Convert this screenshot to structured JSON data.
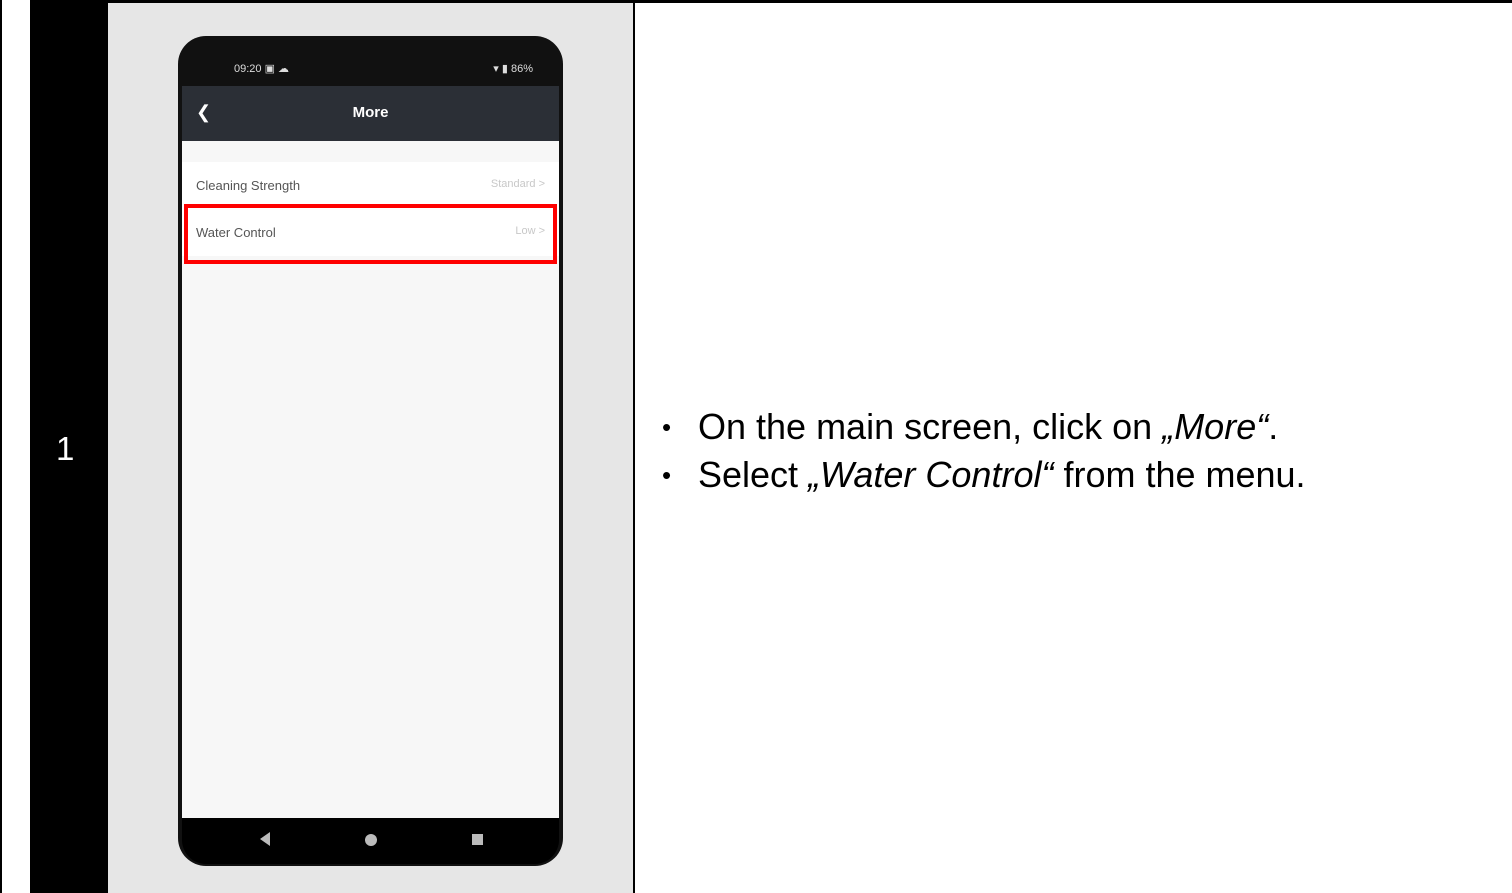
{
  "step": {
    "number": "1"
  },
  "phone": {
    "status_time": "09:20 ▣ ☁",
    "status_right": "▾ ▮ 86%",
    "header_title": "More",
    "menu_items": [
      {
        "label": "Cleaning Strength",
        "value": "Standard >"
      },
      {
        "label": "Water Control",
        "value": "Low >"
      }
    ]
  },
  "instructions": {
    "bullet1_prefix": "On the main screen, click on ",
    "bullet1_em": "„More“",
    "bullet1_suffix": ".",
    "bullet2_prefix": "Select ",
    "bullet2_em": "„Water Control“",
    "bullet2_suffix": " from the menu."
  },
  "colors": {
    "highlight": "#ff0000",
    "header_bg": "#2b2f36"
  }
}
